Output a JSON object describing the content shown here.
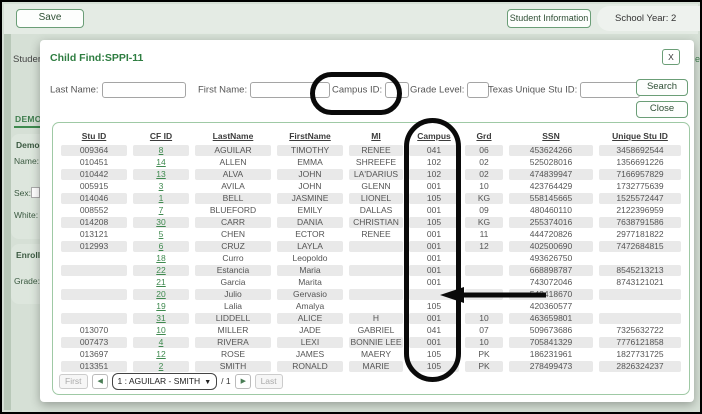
{
  "colors": {
    "accent_green": "#3f8a4f",
    "annotation_black": "#0a0a0a",
    "cell_gray": "#e9e9e9"
  },
  "topbar": {
    "save_label": "Save",
    "student_information_label": "Student Information",
    "school_year_label": "School Year: 2"
  },
  "background": {
    "student_label": "Student:",
    "right_edge_fragment": "ect",
    "tab_label": "DEMOG",
    "panel1_title": "Demo",
    "name_label": "Name:",
    "sex_label": "Sex:",
    "white_label": "White:",
    "panel2_title": "Enroll",
    "grade_label": "Grade:"
  },
  "dialog": {
    "title": "Child Find:SPPI-11",
    "close_x": "X",
    "search": {
      "last_name_label": "Last Name:",
      "first_name_label": "First Name:",
      "campus_id_label": "Campus ID:",
      "grade_level_label": "Grade Level:",
      "unique_id_label": "Texas Unique Stu ID:",
      "search_button": "Search",
      "close_button": "Close"
    },
    "table": {
      "headers": [
        "Stu ID",
        "CF ID",
        "LastName",
        "FirstName",
        "MI",
        "Campus",
        "Grd",
        "SSN",
        "Unique Stu ID"
      ],
      "rows": [
        [
          "009364",
          "8",
          "AGUILAR",
          "TIMOTHY",
          "RENEE",
          "041",
          "06",
          "453624266",
          "3458692544"
        ],
        [
          "010451",
          "14",
          "ALLEN",
          "EMMA",
          "SHREEFE",
          "102",
          "02",
          "525028016",
          "1356691226"
        ],
        [
          "010442",
          "13",
          "ALVA",
          "JOHN",
          "LA'DARIUS",
          "102",
          "02",
          "474839947",
          "7166957829"
        ],
        [
          "005915",
          "3",
          "AVILA",
          "JOHN",
          "GLENN",
          "001",
          "10",
          "423764429",
          "1732775639"
        ],
        [
          "014046",
          "1",
          "BELL",
          "JASMINE",
          "LIONEL",
          "105",
          "KG",
          "558145665",
          "1525572447"
        ],
        [
          "008552",
          "7",
          "BLUEFORD",
          "EMILY",
          "DALLAS",
          "001",
          "09",
          "480460110",
          "2122396959"
        ],
        [
          "014208",
          "30",
          "CARR",
          "DANIA",
          "CHRISTIAN",
          "105",
          "KG",
          "255374016",
          "7638791586"
        ],
        [
          "013121",
          "5",
          "CHEN",
          "ECTOR",
          "RENEE",
          "001",
          "11",
          "444720826",
          "2977181822"
        ],
        [
          "012993",
          "6",
          "CRUZ",
          "LAYLA",
          "",
          "001",
          "12",
          "402500690",
          "7472684815"
        ],
        [
          "",
          "18",
          "Curro",
          "Leopoldo",
          "",
          "001",
          "",
          "493626750",
          ""
        ],
        [
          "",
          "22",
          "Estancia",
          "Maria",
          "",
          "001",
          "",
          "668898787",
          "8545213213"
        ],
        [
          "",
          "21",
          "Garcia",
          "Marita",
          "",
          "001",
          "",
          "743072046",
          "8743121021"
        ],
        [
          "",
          "20",
          "Julio",
          "Gervasio",
          "",
          "",
          "",
          "542418670",
          ""
        ],
        [
          "",
          "19",
          "Lalia",
          "Amalya",
          "",
          "105",
          "",
          "420360577",
          ""
        ],
        [
          "",
          "31",
          "LIDDELL",
          "ALICE",
          "H",
          "001",
          "10",
          "463659801",
          ""
        ],
        [
          "013070",
          "10",
          "MILLER",
          "JADE",
          "GABRIEL",
          "041",
          "07",
          "509673686",
          "7325632722"
        ],
        [
          "007473",
          "4",
          "RIVERA",
          "LEXI",
          "BONNIE LEE",
          "001",
          "10",
          "705841329",
          "7776121858"
        ],
        [
          "013697",
          "12",
          "ROSE",
          "JAMES",
          "MAERY",
          "105",
          "PK",
          "186231961",
          "1827731725"
        ],
        [
          "013351",
          "2",
          "SMITH",
          "RONALD",
          "MARIE",
          "105",
          "PK",
          "278499473",
          "2826324237"
        ]
      ]
    },
    "pagination": {
      "first": "First",
      "prev": "◀",
      "page_select": "1 : AGUILAR - SMITH",
      "caret": "▼",
      "page_info": "/ 1",
      "next": "▶",
      "last": "Last"
    }
  }
}
